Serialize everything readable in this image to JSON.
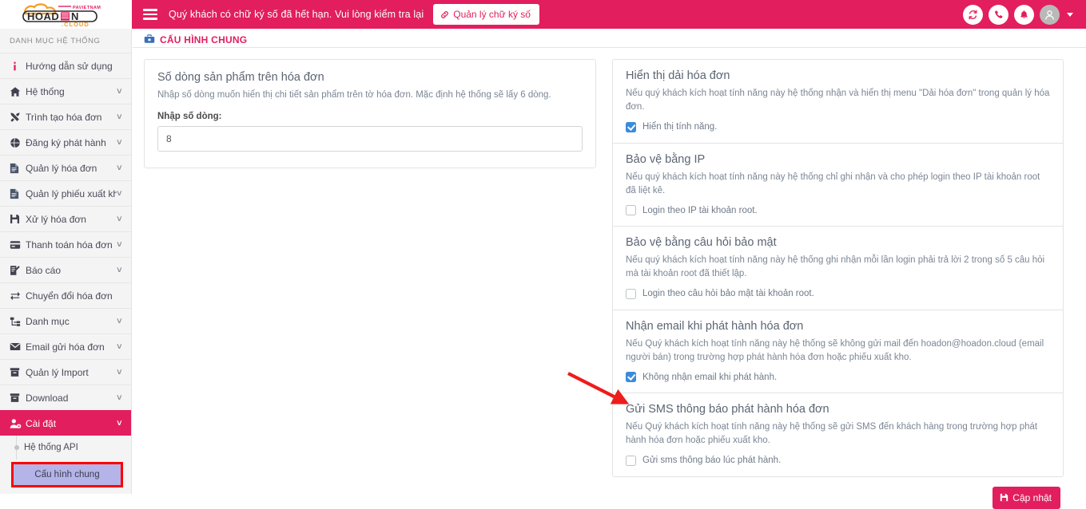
{
  "brand": {
    "logo_text_1": "HOAD",
    "logo_text_2": "N",
    "logo_sub": ".CLOUD",
    "logo_tag": "PAVIETNAM",
    "accent_pink": "#e21e5e",
    "accent_blue": "#3b8bdd",
    "highlight_purple": "#b4b4e8",
    "annotation_red": "#ff0000"
  },
  "topbar": {
    "menu_icon": "hamburger-icon",
    "message": "Quý khách có chữ ký số đã hết hạn. Vui lòng kiểm tra lại",
    "signature_button": "Quản lý chữ ký số",
    "signature_icon": "link-icon",
    "icons": [
      {
        "name": "sync-icon",
        "glyph": "↻"
      },
      {
        "name": "phone-icon",
        "glyph": "☎"
      },
      {
        "name": "bell-icon",
        "glyph": "🔔"
      },
      {
        "name": "user-avatar-icon",
        "glyph": "👤"
      }
    ]
  },
  "sidebar": {
    "title": "DANH MỤC HỆ THỐNG",
    "items": [
      {
        "label": "Hướng dẫn sử dụng",
        "icon": "info-icon",
        "chevron": false,
        "active": false
      },
      {
        "label": "Hệ thống",
        "icon": "home-icon",
        "chevron": true,
        "active": false
      },
      {
        "label": "Trình tạo hóa đơn",
        "icon": "tools-icon",
        "chevron": true,
        "active": false
      },
      {
        "label": "Đăng ký phát hành",
        "icon": "globe-icon",
        "chevron": true,
        "active": false
      },
      {
        "label": "Quản lý hóa đơn",
        "icon": "file-text-icon",
        "chevron": true,
        "active": false
      },
      {
        "label": "Quản lý phiếu xuất kho",
        "icon": "file-text-icon",
        "chevron": true,
        "active": false
      },
      {
        "label": "Xử lý hóa đơn",
        "icon": "save-icon",
        "chevron": true,
        "active": false
      },
      {
        "label": "Thanh toán hóa đơn",
        "icon": "credit-card-icon",
        "chevron": true,
        "active": false
      },
      {
        "label": "Báo cáo",
        "icon": "report-edit-icon",
        "chevron": true,
        "active": false
      },
      {
        "label": "Chuyển đổi hóa đơn",
        "icon": "exchange-icon",
        "chevron": false,
        "active": false
      },
      {
        "label": "Danh mục",
        "icon": "sitemap-icon",
        "chevron": true,
        "active": false
      },
      {
        "label": "Email gửi hóa đơn",
        "icon": "envelope-icon",
        "chevron": true,
        "active": false
      },
      {
        "label": "Quản lý Import",
        "icon": "archive-icon",
        "chevron": true,
        "active": false
      },
      {
        "label": "Download",
        "icon": "archive-icon",
        "chevron": true,
        "active": false
      },
      {
        "label": "Cài đặt",
        "icon": "user-gear-icon",
        "chevron": true,
        "active": true
      }
    ],
    "subitems": [
      {
        "label": "Hệ thống API",
        "highlighted": false
      },
      {
        "label": "Cấu hình chung",
        "highlighted": true
      }
    ]
  },
  "breadcrumb": {
    "icon": "toolbox-icon",
    "text": "CẤU HÌNH CHUNG"
  },
  "left_panel": {
    "title": "Số dòng sản phẩm trên hóa đơn",
    "desc": "Nhập số dòng muốn hiển thị chi tiết sản phẩm trên tờ hóa đơn. Mặc định hệ thống sẽ lấy 6 dòng.",
    "field_label": "Nhập số dòng:",
    "input_value": "8",
    "input_placeholder": ""
  },
  "right_panel": {
    "sections": [
      {
        "title": "Hiển thị dải hóa đơn",
        "desc": "Nếu quý khách kích hoạt tính năng này hệ thống nhận và hiển thị menu \"Dải hóa đơn\" trong quản lý hóa đơn.",
        "checkbox_label": "Hiển thị tính năng.",
        "checked": true
      },
      {
        "title": "Bảo vệ bằng IP",
        "desc": "Nếu quý khách kích hoạt tính năng này hệ thống chỉ ghi nhận và cho phép login theo IP tài khoản root đã liệt kê.",
        "checkbox_label": "Login theo IP tài khoản root.",
        "checked": false
      },
      {
        "title": "Bảo vệ bằng câu hỏi bảo mật",
        "desc": "Nếu quý khách kích hoạt tính năng này hệ thống ghi nhận mỗi lần login phải trả lời 2 trong số 5 câu hỏi mà tài khoản root đã thiết lập.",
        "checkbox_label": "Login theo câu hỏi bảo mật tài khoản root.",
        "checked": false
      },
      {
        "title": "Nhận email khi phát hành hóa đơn",
        "desc": "Nếu Quý khách kích hoạt tính năng này hệ thống sẽ không gửi mail đến hoadon@hoadon.cloud (email người bán) trong trường hợp phát hành hóa đơn hoặc phiếu xuất kho.",
        "checkbox_label": "Không nhận email khi phát hành.",
        "checked": true
      },
      {
        "title": "Gửi SMS thông báo phát hành hóa đơn",
        "desc": "Nếu Quý khách kích hoạt tính năng này hệ thống sẽ gửi SMS đến khách hàng trong trường hợp phát hành hóa đơn hoặc phiếu xuất kho.",
        "checkbox_label": "Gửi sms thông báo lúc phát hành.",
        "checked": false
      }
    ],
    "update_button": "Cập nhật",
    "update_icon": "save-icon"
  }
}
